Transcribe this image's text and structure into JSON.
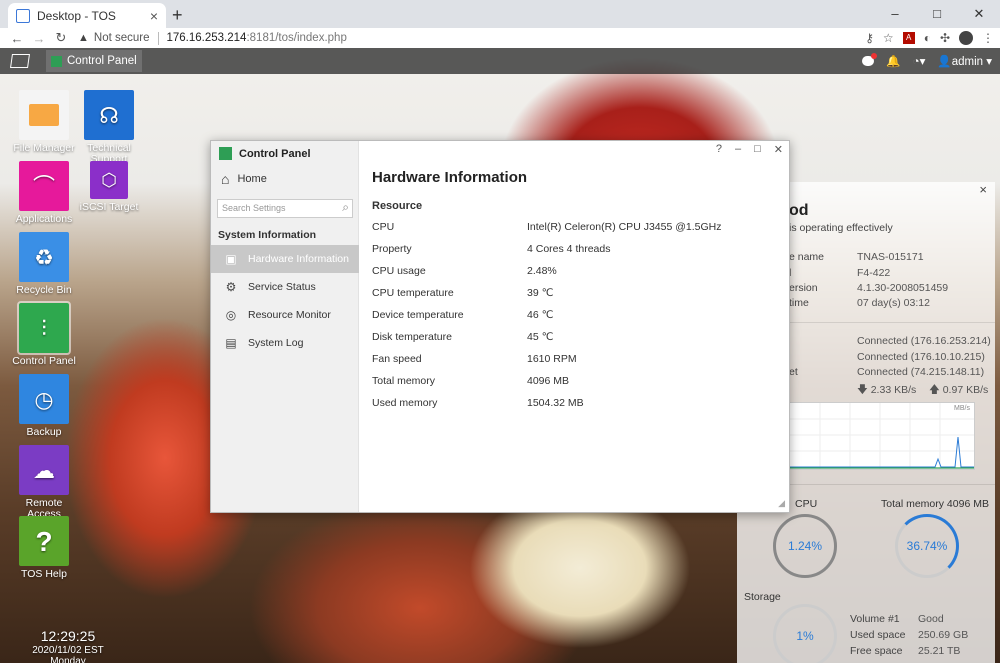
{
  "browser": {
    "tab_title": "Desktop - TOS",
    "new_tab": "+",
    "close_tab": "×",
    "win_min": "–",
    "win_max": "□",
    "win_close": "✕",
    "not_secure": "Not secure",
    "url_host": "176.16.253.214",
    "url_rest": ":8181/tos/index.php"
  },
  "taskbar": {
    "active_app": "Control Panel",
    "user": "admin"
  },
  "desktop_icons": [
    {
      "label": "File Manager",
      "icon": "folder-icon",
      "color": "#f7a844"
    },
    {
      "label": "Technical Support",
      "icon": "headset-icon",
      "color": "#1f6fd1"
    },
    {
      "label": "Applications",
      "icon": "bag-icon",
      "color": "#e6199b"
    },
    {
      "label": "iSCSI Target",
      "icon": "cubes-icon",
      "color": "#8b2fc9"
    },
    {
      "label": "Recycle Bin",
      "icon": "recycle-icon",
      "color": "#3a8fe6"
    },
    {
      "label": "Control Panel",
      "icon": "sliders-icon",
      "color": "#2ea84e"
    },
    {
      "label": "Backup",
      "icon": "backup-icon",
      "color": "#2f86e0"
    },
    {
      "label": "Remote Access",
      "icon": "cloud-icon",
      "color": "#7b3cc4"
    },
    {
      "label": "TOS Help",
      "icon": "help-icon",
      "color": "#5aa42a"
    }
  ],
  "clock": {
    "time": "12:29:25",
    "date": "2020/11/02 EST Monday"
  },
  "status_panel": {
    "heading": "od",
    "subtitle": "is operating effectively",
    "info": [
      {
        "k": "e name",
        "v": "TNAS-015171"
      },
      {
        "k": "l",
        "v": "F4-422"
      },
      {
        "k": "ersion",
        "v": "4.1.30-2008051459"
      },
      {
        "k": "time",
        "v": "07 day(s) 03:12"
      }
    ],
    "net": [
      {
        "k": "",
        "v": "Connected (176.16.253.214)"
      },
      {
        "k": "",
        "v": "Connected (176.10.10.215)"
      },
      {
        "k": "et",
        "v": "Connected (74.215.148.11)"
      }
    ],
    "download": "2.33 KB/s",
    "upload": "0.97 KB/s",
    "graph_unit": "MB/s",
    "cpu_label": "CPU",
    "cpu_value": "1.24%",
    "mem_label": "Total memory 4096 MB",
    "mem_value": "36.74%",
    "storage_label": "Storage",
    "storage_value": "1%",
    "volume": [
      {
        "k": "Volume #1",
        "v": "Good"
      },
      {
        "k": "Used space",
        "v": "250.69 GB"
      },
      {
        "k": "Free space",
        "v": "25.21 TB"
      }
    ]
  },
  "control_panel": {
    "title": "Control Panel",
    "home": "Home",
    "search_placeholder": "Search Settings",
    "section": "System Information",
    "menu": [
      {
        "label": "Hardware Information",
        "icon": "hardware-icon"
      },
      {
        "label": "Service Status",
        "icon": "service-icon"
      },
      {
        "label": "Resource Monitor",
        "icon": "monitor-icon"
      },
      {
        "label": "System Log",
        "icon": "log-icon"
      }
    ],
    "help": "?",
    "page_title": "Hardware Information",
    "group": "Resource",
    "rows": [
      {
        "k": "CPU",
        "v": "Intel(R) Celeron(R) CPU J3455 @1.5GHz"
      },
      {
        "k": "Property",
        "v": "4 Cores 4 threads"
      },
      {
        "k": "CPU usage",
        "v": "2.48%"
      },
      {
        "k": "CPU temperature",
        "v": "39 ℃"
      },
      {
        "k": "Device temperature",
        "v": "46 ℃"
      },
      {
        "k": "Disk temperature",
        "v": "45 ℃"
      },
      {
        "k": "Fan speed",
        "v": "1610 RPM"
      },
      {
        "k": "Total memory",
        "v": "4096 MB"
      },
      {
        "k": "Used memory",
        "v": "1504.32 MB"
      }
    ]
  }
}
